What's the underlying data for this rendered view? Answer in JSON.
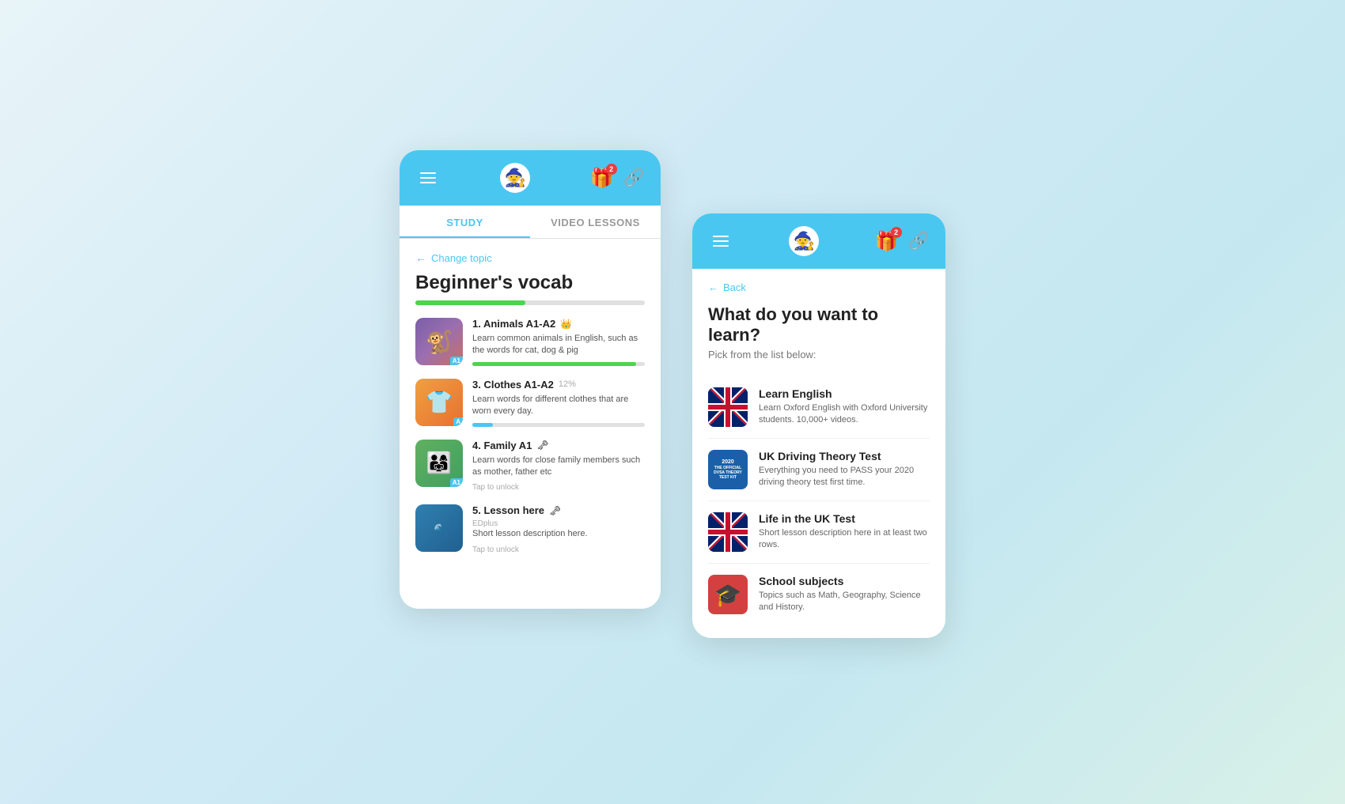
{
  "left_phone": {
    "header": {
      "avatar_emoji": "🧙",
      "badge_count": "2",
      "badge_emoji": "🎁",
      "link_emoji": "🔗"
    },
    "tabs": [
      {
        "label": "STUDY",
        "active": true
      },
      {
        "label": "VIDEO LESSONS",
        "active": false
      }
    ],
    "change_topic_label": "Change topic",
    "topic_title": "Beginner's vocab",
    "progress_percent": 48,
    "lessons": [
      {
        "number": "1.",
        "title": "Animals",
        "level": "A1-A2",
        "crown": "👑",
        "description": "Learn common animals in English, such as the words for cat, dog & pig",
        "progress_percent": 95,
        "progress_color": "green",
        "badge": "A1"
      },
      {
        "number": "3.",
        "title": "Clothes",
        "level": "A1-A2",
        "percent_label": "12%",
        "description": "Learn words for different clothes that are worn every day.",
        "progress_percent": 12,
        "progress_color": "blue",
        "badge": "A"
      },
      {
        "number": "4.",
        "title": "Family",
        "level": "A1",
        "key_emoji": "🗝",
        "description": "Learn words for close family members such as mother, father etc",
        "sub_label": "Tap to unlock",
        "badge": "A1"
      },
      {
        "number": "5.",
        "title": "Lesson here",
        "key_emoji": "🗝",
        "sub_label": "EDplus",
        "description": "Short lesson description here.",
        "tap_label": "Tap to unlock"
      }
    ]
  },
  "right_phone": {
    "header": {
      "avatar_emoji": "🧙",
      "badge_count": "2",
      "badge_emoji": "🎁",
      "link_emoji": "🔗"
    },
    "back_label": "Back",
    "title": "What do you want to learn?",
    "subtitle": "Pick from the list below:",
    "topics": [
      {
        "name": "Learn English",
        "description": "Learn Oxford English with Oxford University students. 10,000+ videos.",
        "flag": "uk"
      },
      {
        "name": "UK Driving Theory Test",
        "description": "Everything  you need to PASS your 2020 driving theory test first time.",
        "flag": "driving"
      },
      {
        "name": "Life in the UK Test",
        "description": "Short lesson description here in at least two rows.",
        "flag": "uk"
      },
      {
        "name": "School subjects",
        "description": "Topics such as Math, Geography, Science and History.",
        "flag": "school"
      }
    ]
  }
}
